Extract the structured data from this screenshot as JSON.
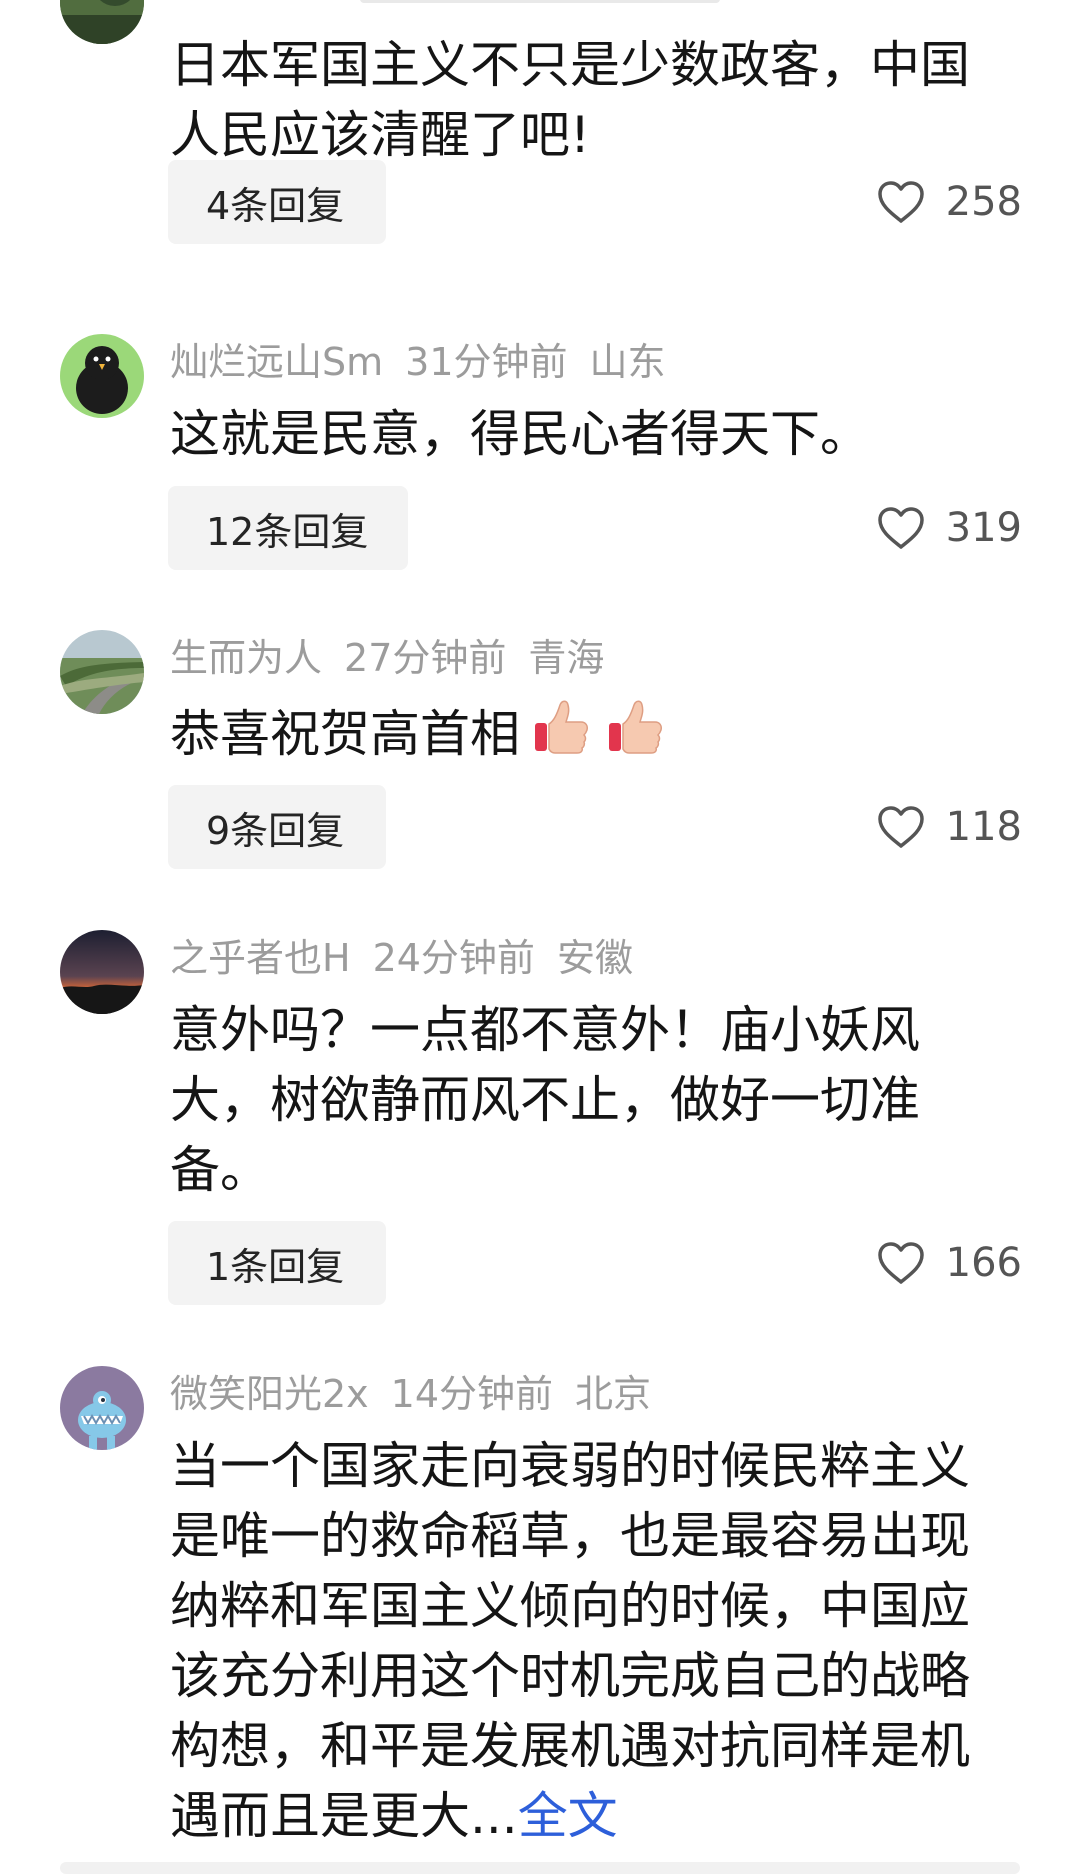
{
  "comments": [
    {
      "text": "日本军国主义不只是少数政客，中国人民应该清醒了吧!",
      "reply_label": "4条回复",
      "likes": "258"
    },
    {
      "username": "灿烂远山Sm",
      "time": "31分钟前",
      "location": "山东",
      "text": "这就是民意，得民心者得天下。",
      "reply_label": "12条回复",
      "likes": "319"
    },
    {
      "username": "生而为人",
      "time": "27分钟前",
      "location": "青海",
      "text": "恭喜祝贺高首相",
      "reply_label": "9条回复",
      "likes": "118"
    },
    {
      "username": "之乎者也H",
      "time": "24分钟前",
      "location": "安徽",
      "text": "意外吗？一点都不意外！庙小妖风大，树欲静而风不止，做好一切准备。",
      "reply_label": "1条回复",
      "likes": "166"
    },
    {
      "username": "微笑阳光2x",
      "time": "14分钟前",
      "location": "北京",
      "text": "当一个国家走向衰弱的时候民粹主义是唯一的救命稻草，也是最容易出现纳粹和军国主义倾向的时候，中国应该充分利用这个时机完成自己的战略构想，和平是发展机遇对抗同样是机遇而且是更大...",
      "expand_label": "全文"
    }
  ]
}
